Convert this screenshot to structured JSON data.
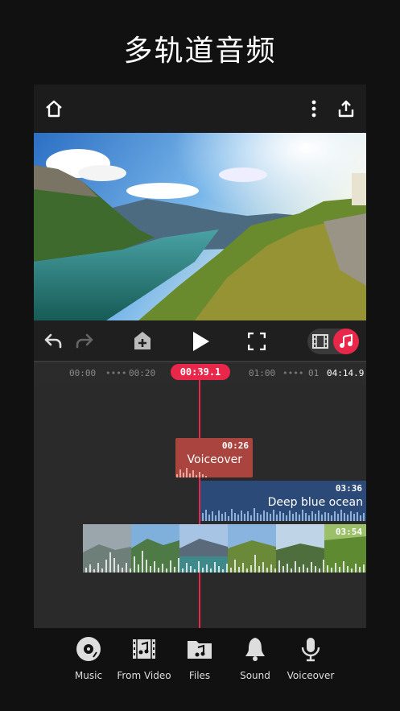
{
  "headline": "多轨道音频",
  "timeline": {
    "ticks": [
      "00:00",
      "00:20",
      "01:00",
      "01",
      "04:14.9"
    ],
    "current_time": "00:39.1"
  },
  "clips": {
    "voiceover": {
      "name": "Voiceover",
      "duration": "00:26"
    },
    "music": {
      "name": "Deep blue ocean",
      "duration": "03:36"
    },
    "video": {
      "duration": "03:54"
    }
  },
  "toolbar": {
    "items": [
      {
        "label": "Music",
        "icon": "music-disc-icon"
      },
      {
        "label": "From Video",
        "icon": "film-music-icon"
      },
      {
        "label": "Files",
        "icon": "music-folder-icon"
      },
      {
        "label": "Sound",
        "icon": "bell-icon"
      },
      {
        "label": "Voiceover",
        "icon": "microphone-icon"
      }
    ]
  },
  "colors": {
    "accent": "#e8274a",
    "voice_clip": "#a9443f",
    "music_clip": "#2c4a78"
  }
}
